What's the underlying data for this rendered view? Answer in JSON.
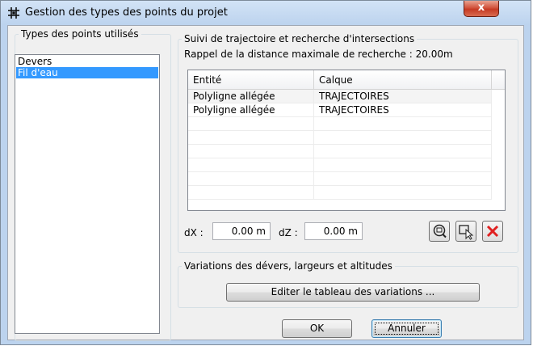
{
  "window": {
    "title": "Gestion des types des points du projet",
    "close_glyph": "x"
  },
  "types_panel": {
    "legend": "Types des points utilisés",
    "items": [
      {
        "label": "Devers",
        "selected": false
      },
      {
        "label": "Fil d'eau",
        "selected": true
      }
    ]
  },
  "tracking_panel": {
    "legend": "Suivi de trajectoire et recherche d'intersections",
    "distance_label": "Rappel de la distance maximale de recherche : 20.00m",
    "columns": [
      "Entité",
      "Calque"
    ],
    "rows": [
      {
        "entity": "Polyligne allégée",
        "layer": "TRAJECTOIRES"
      },
      {
        "entity": "Polyligne allégée",
        "layer": "TRAJECTOIRES"
      }
    ],
    "dx_label": "dX :",
    "dx_value": "0.00 m",
    "dz_label": "dZ :",
    "dz_value": "0.00 m",
    "icons": [
      "zoom-select-icon",
      "pick-entity-icon",
      "delete-icon"
    ]
  },
  "variations_panel": {
    "legend": "Variations des dévers, largeurs et altitudes",
    "edit_button": "Editer le tableau des variations ..."
  },
  "footer": {
    "ok_label": "OK",
    "cancel_label": "Annuler"
  },
  "colors": {
    "selection": "#3399ff",
    "delete_red": "#e02020"
  }
}
